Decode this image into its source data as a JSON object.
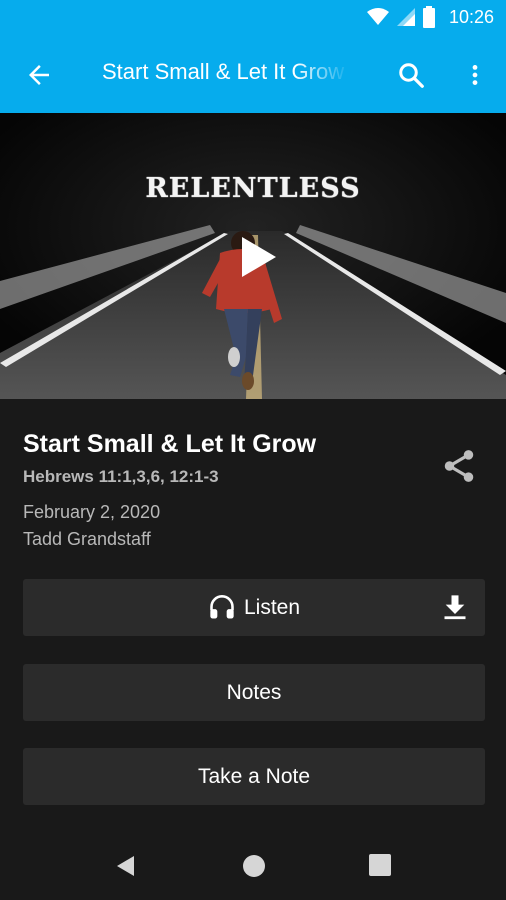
{
  "status_bar": {
    "time": "10:26"
  },
  "app_bar": {
    "title": "Start Small & Let It Grow"
  },
  "hero": {
    "series_title": "RELENTLESS"
  },
  "episode": {
    "title": "Start Small & Let It Grow",
    "scripture": "Hebrews 11:1,3,6, 12:1-3",
    "date": "February 2, 2020",
    "speaker": "Tadd Grandstaff"
  },
  "actions": {
    "listen_label": "Listen",
    "notes_label": "Notes",
    "take_note_label": "Take a Note"
  },
  "icons": {
    "wifi": "wifi-icon",
    "signal": "signal-icon",
    "battery": "battery-icon",
    "back": "arrow-back-icon",
    "search": "search-icon",
    "more": "more-vert-icon",
    "play": "play-icon",
    "share": "share-icon",
    "headphones": "headphones-icon",
    "download": "download-icon"
  },
  "colors": {
    "accent": "#06aced",
    "background": "#191919",
    "button": "#2b2b2b",
    "secondary_text": "#b8b8b8"
  }
}
